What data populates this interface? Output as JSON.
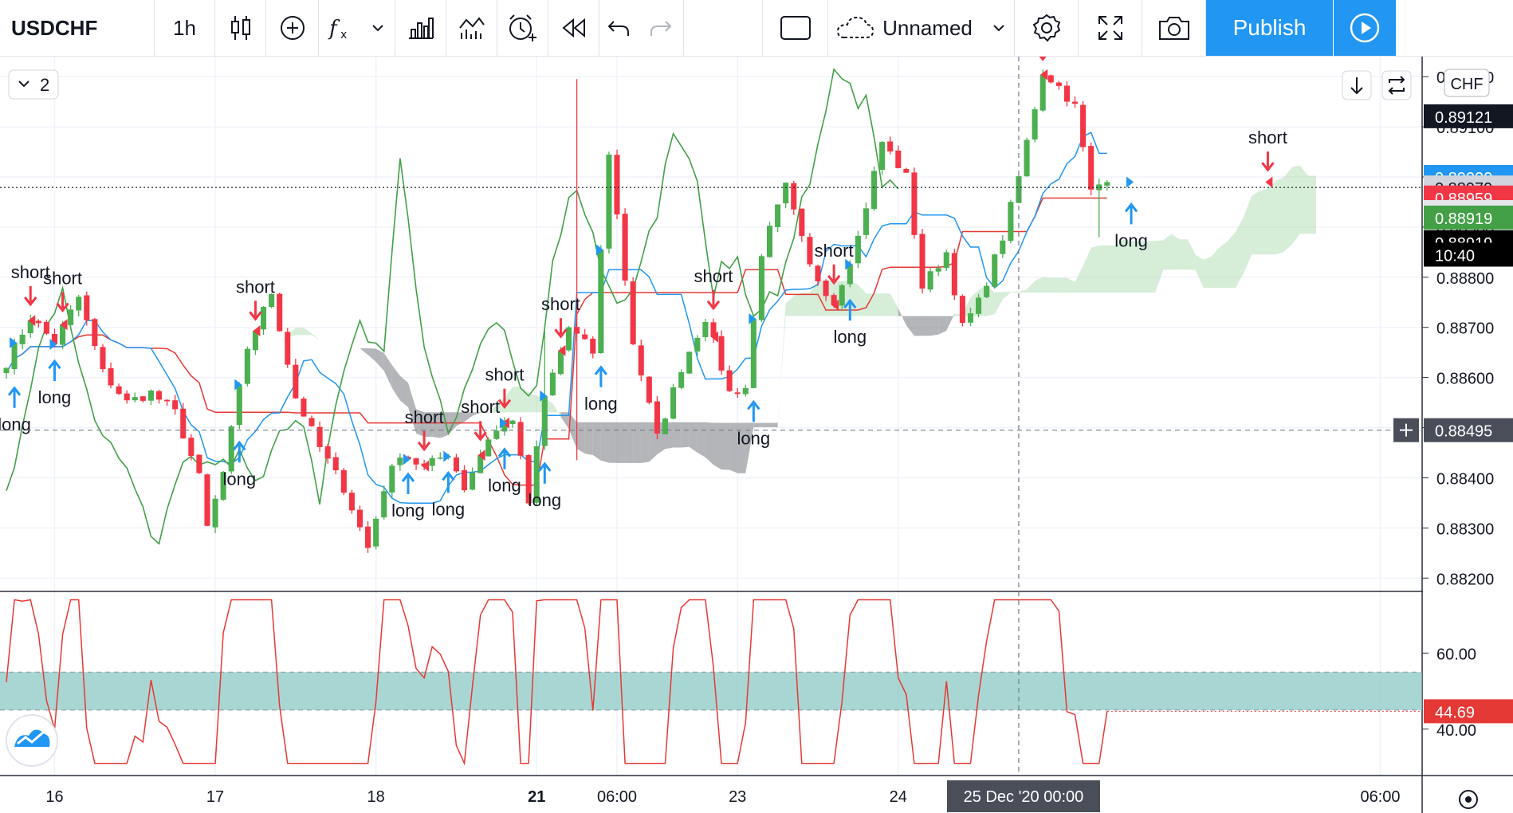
{
  "toolbar": {
    "symbol": "USDCHF",
    "interval": "1h",
    "layout_name": "Unnamed",
    "publish_label": "Publish",
    "icons": [
      "candles-icon",
      "plus-circle-icon",
      "fx-icon",
      "chevron-down-icon",
      "compare-icon",
      "indicators-icon",
      "alert-icon",
      "replay-icon",
      "undo-icon",
      "redo-icon",
      "rectangle-icon",
      "cloud-icon",
      "chevron-down-icon",
      "gear-icon",
      "fullscreen-icon",
      "camera-icon",
      "play-icon"
    ]
  },
  "panel": {
    "collapse_label": "2",
    "currency": "CHF"
  },
  "colors": {
    "up": "#4caf50",
    "down": "#f23645",
    "blue": "#2196f3",
    "tenkan": "#2196f3",
    "kijun": "#e53935",
    "chikou": "#43a047",
    "rsi": "#e53935",
    "rsi_band": "#83c4c0",
    "cloud_bull": "#a5d6a7",
    "cloud_bear": "#8a8d93"
  },
  "chart_data": {
    "type": "candlestick",
    "symbol": "USDCHF",
    "interval": "1h",
    "price_axis": {
      "ticks": [
        "0.88200",
        "0.88300",
        "0.88400",
        "0.88500",
        "0.88600",
        "0.88700",
        "0.88800",
        "0.88900",
        "0.89000",
        "0.89100",
        "0.89200"
      ],
      "range": [
        0.88175,
        0.8924
      ]
    },
    "price_labels": [
      {
        "text": "0.89121",
        "price": 0.89121,
        "bg": "#131722",
        "fg": "#ffffff"
      },
      {
        "text": "0.89000",
        "price": 0.89,
        "bg": "#2196f3",
        "fg": "#ffffff"
      },
      {
        "text": "0.88979",
        "price": 0.88979,
        "bg": "#d1d4dc",
        "fg": "#131722"
      },
      {
        "text": "0.88959",
        "price": 0.88959,
        "bg": "#f23645",
        "fg": "#ffffff"
      },
      {
        "text": "0.88930",
        "price": 0.8893,
        "bg": "#e4e6ea",
        "fg": "#131722"
      },
      {
        "text": "0.88919",
        "price": 0.88919,
        "bg": "#43a047",
        "fg": "#ffffff"
      },
      {
        "text": "0.88919",
        "price": 0.8887,
        "bg": "#000000",
        "fg": "#ffffff"
      },
      {
        "text": "10:40",
        "price": 0.88845,
        "bg": "#000000",
        "fg": "#ffffff"
      }
    ],
    "crosshair": {
      "price": 0.88495,
      "price_label": "0.88495",
      "time_label": "25 Dec '20   00:00"
    },
    "last_price": 0.88979,
    "time_axis": [
      {
        "label": "16",
        "i": 6
      },
      {
        "label": "17",
        "i": 26
      },
      {
        "label": "18",
        "i": 46
      },
      {
        "label": "21",
        "i": 66
      },
      {
        "label": "06:00",
        "i": 76
      },
      {
        "label": "23",
        "i": 91
      },
      {
        "label": "24",
        "i": 111
      },
      {
        "label": "06:00",
        "i": 171
      }
    ],
    "cursor_bar": 126,
    "bar_count": 138,
    "total_slots": 177,
    "anchors": [
      [
        0,
        0.8863
      ],
      [
        3,
        0.8872
      ],
      [
        6,
        0.8867
      ],
      [
        9,
        0.8876
      ],
      [
        12,
        0.8861
      ],
      [
        15,
        0.8855
      ],
      [
        18,
        0.8857
      ],
      [
        21,
        0.8853
      ],
      [
        24,
        0.884
      ],
      [
        25,
        0.883
      ],
      [
        27,
        0.8841
      ],
      [
        30,
        0.8866
      ],
      [
        33,
        0.8877
      ],
      [
        36,
        0.8856
      ],
      [
        39,
        0.8846
      ],
      [
        42,
        0.8838
      ],
      [
        45,
        0.8826
      ],
      [
        47,
        0.8838
      ],
      [
        49,
        0.8845
      ],
      [
        52,
        0.8842
      ],
      [
        55,
        0.8845
      ],
      [
        57,
        0.8838
      ],
      [
        60,
        0.8848
      ],
      [
        63,
        0.8852
      ],
      [
        65,
        0.8835
      ],
      [
        67,
        0.8856
      ],
      [
        70,
        0.887
      ],
      [
        73,
        0.8865
      ],
      [
        75,
        0.8905
      ],
      [
        78,
        0.8867
      ],
      [
        81,
        0.8848
      ],
      [
        84,
        0.8862
      ],
      [
        87,
        0.8872
      ],
      [
        90,
        0.8857
      ],
      [
        92,
        0.8858
      ],
      [
        94,
        0.8885
      ],
      [
        97,
        0.8898
      ],
      [
        100,
        0.8882
      ],
      [
        103,
        0.8875
      ],
      [
        106,
        0.8888
      ],
      [
        109,
        0.8907
      ],
      [
        112,
        0.89
      ],
      [
        114,
        0.8878
      ],
      [
        117,
        0.8885
      ],
      [
        119,
        0.887
      ],
      [
        121,
        0.8875
      ],
      [
        124,
        0.8888
      ],
      [
        126,
        0.89
      ],
      [
        129,
        0.8921
      ],
      [
        131,
        0.8918
      ],
      [
        133,
        0.8914
      ],
      [
        135,
        0.8897
      ],
      [
        137,
        0.89
      ]
    ],
    "signals": [
      {
        "i": 3,
        "type": "short",
        "label": "short"
      },
      {
        "i": 7,
        "type": "short",
        "label": "short"
      },
      {
        "i": 1,
        "type": "long",
        "label": "long"
      },
      {
        "i": 6,
        "type": "long",
        "label": "long"
      },
      {
        "i": 31,
        "type": "short",
        "label": "short"
      },
      {
        "i": 29,
        "type": "long",
        "label": "long"
      },
      {
        "i": 52,
        "type": "short",
        "label": "short"
      },
      {
        "i": 59,
        "type": "short",
        "label": "short"
      },
      {
        "i": 69,
        "type": "short",
        "label": "short"
      },
      {
        "i": 62,
        "type": "short",
        "label": "short"
      },
      {
        "i": 50,
        "type": "long",
        "label": "long"
      },
      {
        "i": 55,
        "type": "long",
        "label": "long"
      },
      {
        "i": 62,
        "type": "long",
        "label": "long"
      },
      {
        "i": 67,
        "type": "long",
        "label": "long"
      },
      {
        "i": 74,
        "type": "long",
        "label": "long"
      },
      {
        "i": 88,
        "type": "short",
        "label": "short"
      },
      {
        "i": 103,
        "type": "short",
        "label": "short"
      },
      {
        "i": 93,
        "type": "long",
        "label": "long"
      },
      {
        "i": 105,
        "type": "long",
        "label": "long"
      },
      {
        "i": 129,
        "type": "short",
        "label": "short"
      },
      {
        "i": 140,
        "type": "long",
        "label": "long"
      },
      {
        "i": 157,
        "type": "short",
        "label": "short"
      }
    ],
    "rsi": {
      "ticks": [
        "40.00",
        "60.00"
      ],
      "range": [
        28,
        76
      ],
      "band": [
        45,
        55
      ],
      "last": 44.69,
      "last_label": "44.69"
    }
  }
}
